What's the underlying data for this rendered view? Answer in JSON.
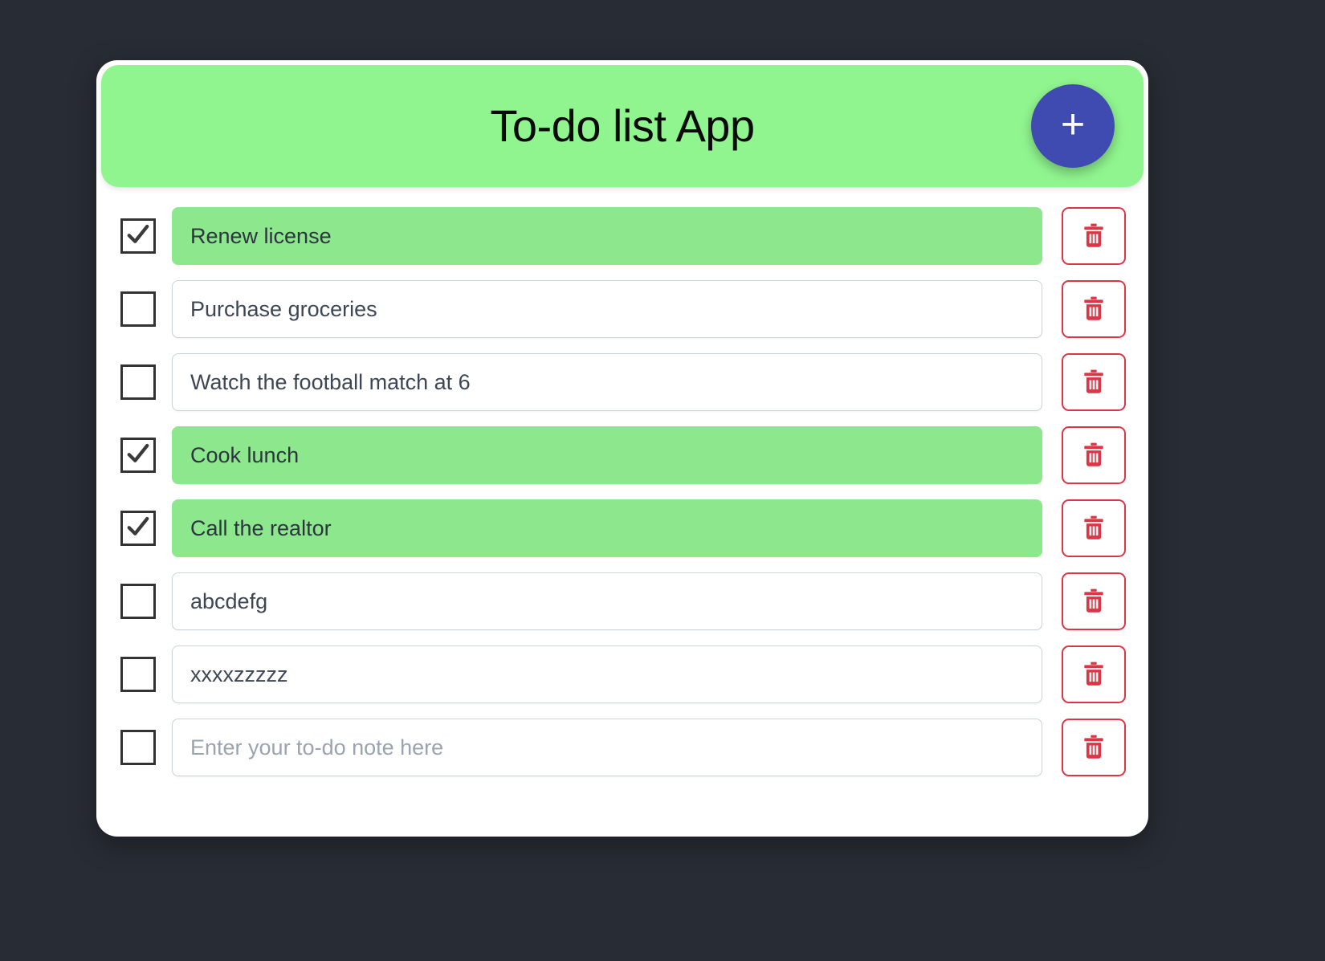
{
  "app": {
    "title": "To-do list App",
    "add_button_label": "+",
    "add_button_icon": "plus-icon",
    "background_color": "#282c34",
    "header_color": "#90f58f",
    "accent_color": "#3f4bb0",
    "completed_color": "#8ce78d",
    "delete_color": "#dc3545"
  },
  "todos": [
    {
      "text": "Renew license",
      "placeholder": "Enter your to-do note here",
      "done": true,
      "delete_icon": "trash-icon"
    },
    {
      "text": "Purchase groceries",
      "placeholder": "Enter your to-do note here",
      "done": false,
      "delete_icon": "trash-icon"
    },
    {
      "text": "Watch the football match at 6",
      "placeholder": "Enter your to-do note here",
      "done": false,
      "delete_icon": "trash-icon"
    },
    {
      "text": "Cook lunch",
      "placeholder": "Enter your to-do note here",
      "done": true,
      "delete_icon": "trash-icon"
    },
    {
      "text": "Call the realtor",
      "placeholder": "Enter your to-do note here",
      "done": true,
      "delete_icon": "trash-icon"
    },
    {
      "text": "abcdefg",
      "placeholder": "Enter your to-do note here",
      "done": false,
      "delete_icon": "trash-icon"
    },
    {
      "text": "xxxxzzzzz",
      "placeholder": "Enter your to-do note here",
      "done": false,
      "delete_icon": "trash-icon"
    },
    {
      "text": "",
      "placeholder": "Enter your to-do note here",
      "done": false,
      "delete_icon": "trash-icon"
    }
  ]
}
